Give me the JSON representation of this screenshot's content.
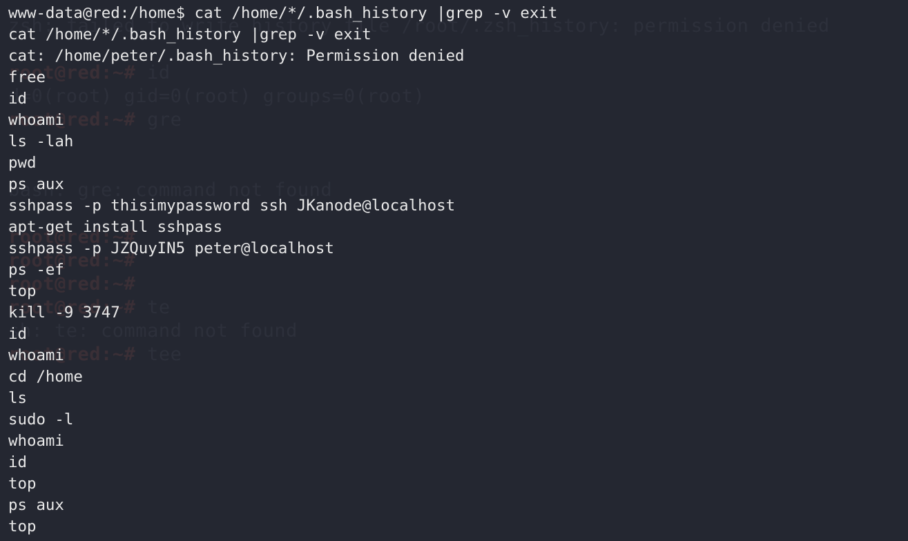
{
  "terminal": {
    "lines": [
      "www-data@red:/home$ cat /home/*/.bash_history |grep -v exit",
      "cat /home/*/.bash_history |grep -v exit",
      "cat: /home/peter/.bash_history: Permission denied",
      "free",
      "id",
      "whoami",
      "ls -lah",
      "pwd",
      "ps aux",
      "sshpass -p thisimypassword ssh JKanode@localhost",
      "apt-get install sshpass",
      "sshpass -p JZQuyIN5 peter@localhost",
      "ps -ef",
      "top",
      "kill -9 3747",
      "id",
      "whoami",
      "cd /home",
      "ls",
      "sudo -l",
      "whoami",
      "id",
      "top",
      "ps aux",
      "top"
    ],
    "cursor_symbol": "█"
  },
  "ghost": {
    "lines": [
      "zsh: failed to write history file /root/.zsh_history: permission denied",
      "id",
      "d=0(root) gid=0(root) groups=0(root)",
      "gre",
      "bash: gre: command not found",
      "te",
      "sh: te: command not found",
      "tee"
    ],
    "prompt": "root@red:~#"
  },
  "colors": {
    "background": "#242731",
    "text": "#e8e8e8",
    "cursor": "#ffffff"
  }
}
